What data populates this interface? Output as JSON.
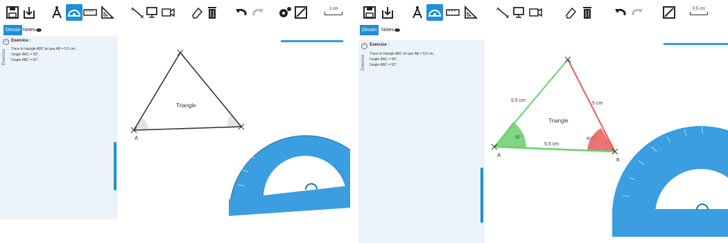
{
  "left": {
    "tabs": {
      "draw": "Dessin",
      "notes": "Notes"
    },
    "scale_label": "1 cm",
    "exercise_side_label": "Exercice",
    "exercise": {
      "title": "Exercice :",
      "lines": [
        "Trace le triangle ABC tel que AB = 5,5 cm,",
        "l'angle BAC = 55°,",
        "l'angle ABC = 52°."
      ]
    },
    "triangle": {
      "name": "Triangle",
      "points": {
        "A": "A",
        "B": "B"
      }
    }
  },
  "right": {
    "tabs": {
      "draw": "Dessin",
      "notes": "Notes"
    },
    "scale_label": "0,5 cm",
    "exercise_side_label": "Exercice",
    "exercise": {
      "title": "Exercice :",
      "lines": [
        "Trace le triangle ABC tel que AB = 5,5 cm,",
        "l'angle BAC = 55°,",
        "l'angle ABC = 52°."
      ]
    },
    "triangle": {
      "name": "Triangle",
      "points": {
        "A": "A",
        "B": "B"
      },
      "lengths": {
        "left_side": "5,5 cm",
        "right_side": "5 cm",
        "base": "5,5 cm"
      },
      "angles": {
        "A": "55 °",
        "B": "60 °"
      }
    }
  },
  "colors": {
    "accent": "#1e8fd8",
    "protractor": "#3a9ee0",
    "green": "#6ccf6c",
    "red": "#e85a5a"
  }
}
